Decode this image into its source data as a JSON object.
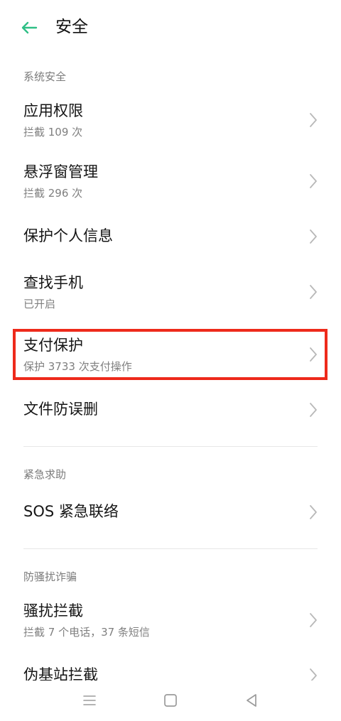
{
  "header": {
    "title": "安全"
  },
  "sections": {
    "system": "系统安全",
    "emergency": "紧急求助",
    "harass": "防骚扰诈骗"
  },
  "items": {
    "app_permission": {
      "title": "应用权限",
      "sub": "拦截 109 次"
    },
    "floating_window": {
      "title": "悬浮窗管理",
      "sub": "拦截 296 次"
    },
    "privacy": {
      "title": "保护个人信息"
    },
    "find_phone": {
      "title": "查找手机",
      "sub": "已开启"
    },
    "payment": {
      "title": "支付保护",
      "sub": "保护 3733 次支付操作"
    },
    "file_protect": {
      "title": "文件防误删"
    },
    "sos": {
      "title": "SOS 紧急联络"
    },
    "harass_block": {
      "title": "骚扰拦截",
      "sub": "拦截 7 个电话，37 条短信"
    },
    "fake_station": {
      "title": "伪基站拦截"
    }
  },
  "icons": {
    "back": "arrow-left-icon",
    "chevron": "chevron-right-icon",
    "nav_menu": "menu-icon",
    "nav_home": "square-home-icon",
    "nav_back": "triangle-back-icon"
  },
  "colors": {
    "accent": "#2fbf86",
    "highlight": "#ee2a1b"
  }
}
